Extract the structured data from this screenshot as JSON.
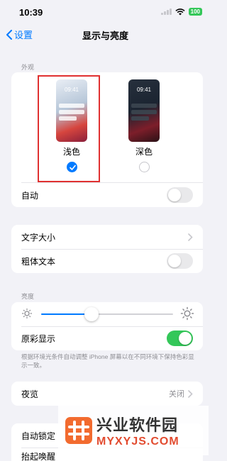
{
  "status_bar": {
    "time": "10:39",
    "battery": "100"
  },
  "nav": {
    "back_label": "设置",
    "title": "显示与亮度"
  },
  "appearance": {
    "header": "外观",
    "options": [
      {
        "label": "浅色",
        "preview_time": "09:41",
        "selected": true
      },
      {
        "label": "深色",
        "preview_time": "09:41",
        "selected": false
      }
    ],
    "auto_label": "自动",
    "auto_on": false
  },
  "text": {
    "text_size_label": "文字大小",
    "bold_text_label": "粗体文本",
    "bold_text_on": false
  },
  "brightness": {
    "header": "亮度",
    "level_percent": 38,
    "true_tone_label": "原彩显示",
    "true_tone_on": true,
    "footnote": "根据环境光条件自动调整 iPhone 屏幕以在不同环境下保持色彩显示一致。"
  },
  "night_shift": {
    "label": "夜览",
    "value": "关闭"
  },
  "lock": {
    "auto_lock_label": "自动锁定",
    "raise_to_wake_label": "抬起唤醒"
  },
  "watermark": {
    "title": "兴业软件园",
    "url": "MYXYJS.COM"
  },
  "colors": {
    "accent": "#007aff",
    "toggle_on": "#34c759",
    "highlight": "#e03131"
  }
}
